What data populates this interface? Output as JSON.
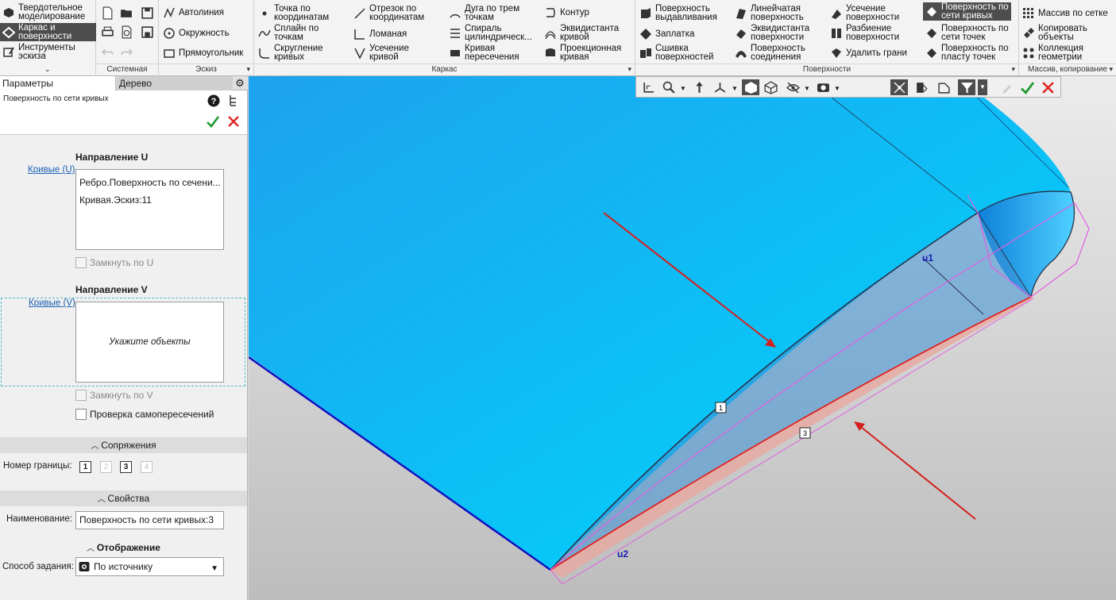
{
  "ribbon": {
    "modes": [
      {
        "label": "Твердотельное\nмоделирование",
        "selected": false
      },
      {
        "label": "Каркас и\nповерхности",
        "selected": true
      },
      {
        "label": "Инструменты\nэскиза",
        "selected": false
      }
    ],
    "groups": {
      "system": "Системная",
      "sketch": "Эскиз",
      "frame": "Каркас",
      "surfaces": "Поверхности",
      "arrays": "Массив, копирование"
    },
    "sketch_items": [
      "Автолиния",
      "Окружность",
      "Прямоугольник"
    ],
    "frame_items": [
      "Точка по\nкоординатам",
      "Сплайн по\nточкам",
      "Скругление\nкривых",
      "Отрезок по\nкоординатам",
      "Ломаная",
      "Усечение\nкривой",
      "Дуга по трем\nточкам",
      "Спираль\nцилиндрическ...",
      "Кривая\nпересечения",
      "Контур",
      "Эквидистанта\nкривой",
      "Проекционная\nкривая"
    ],
    "surface_items": [
      "Поверхность\nвыдавливания",
      "Заплатка",
      "Сшивка\nповерхностей",
      "Линейчатая\nповерхность",
      "Эквидистанта\nповерхности",
      "Поверхность\nсоединения",
      "Усечение\nповерхности",
      "Разбиение\nповерхности",
      "Удалить грани",
      "Поверхность по\nсети кривых",
      "Поверхность по\nсети точек",
      "Поверхность по\nпласту точек"
    ],
    "array_items": [
      "Массив по сетке",
      "Копировать\nобъекты",
      "Коллекция\nгеометрии"
    ]
  },
  "panel": {
    "tabs": [
      "Параметры",
      "Дерево"
    ],
    "command_title": "Поверхность по сети кривых",
    "dir_u": {
      "title": "Направление U",
      "link": "Кривые (U)",
      "items": [
        "Ребро.Поверхность по сечени...",
        "Кривая.Эскиз:11"
      ],
      "close_label": "Замкнуть по U"
    },
    "dir_v": {
      "title": "Направление V",
      "link": "Кривые (V)",
      "placeholder": "Укажите объекты",
      "close_label": "Замкнуть по V"
    },
    "self_intersect_label": "Проверка самопересечений",
    "conjugations": {
      "title": "Сопряжения",
      "boundary_label": "Номер границы:",
      "boundaries": [
        "1",
        "2",
        "3",
        "4"
      ]
    },
    "properties": {
      "title": "Свойства",
      "name_label": "Наименование:",
      "name_value": "Поверхность по сети кривых:3"
    },
    "display": {
      "title": "Отображение",
      "method_label": "Способ задания:",
      "method_value": "По источнику"
    }
  },
  "viewport": {
    "markers": [
      "1",
      "3"
    ],
    "labels": [
      "u1",
      "u2"
    ],
    "colors": {
      "surface": "#12b5f0",
      "arrow": "#d42020",
      "guide": "#e060e0",
      "edge": "#1010c0"
    }
  }
}
